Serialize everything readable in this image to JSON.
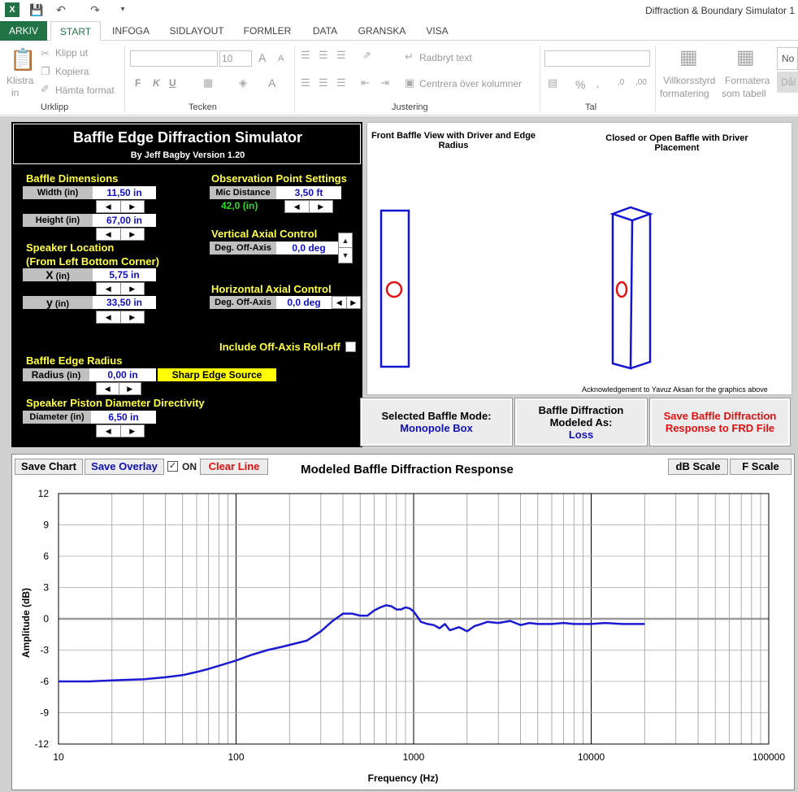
{
  "window": {
    "title": "Diffraction & Boundary Simulator 1"
  },
  "ribbon": {
    "tabs": [
      "ARKIV",
      "START",
      "INFOGA",
      "SIDLAYOUT",
      "FORMLER",
      "DATA",
      "GRANSKA",
      "VISA"
    ],
    "active_tab": "START",
    "clipboard": {
      "paste": "Klistra",
      "paste2": "in",
      "cut": "Klipp ut",
      "copy": "Kopiera",
      "format_painter": "Hämta format",
      "group": "Urklipp"
    },
    "font": {
      "size": "10",
      "bold": "F",
      "italic": "K",
      "underline": "U",
      "grow": "A",
      "shrink": "A",
      "color": "A",
      "group": "Tecken"
    },
    "alignment": {
      "wrap": "Radbryt text",
      "merge": "Centrera över kolumner",
      "group": "Justering"
    },
    "number": {
      "percent": "%",
      "comma": "‚",
      "dec_inc": ",0",
      "dec_dec": ",00",
      "group": "Tal"
    },
    "styles": {
      "conditional1": "Villkorsstyrd",
      "conditional2": "formatering",
      "table1": "Formatera",
      "table2": "som tabell",
      "normal": "No",
      "bad": "Dål"
    }
  },
  "simulator": {
    "title": "Baffle Edge Diffraction Simulator",
    "subtitle": "By Jeff Bagby Version 1.20",
    "baffle_dimensions": "Baffle Dimensions",
    "width_label": "Width (in)",
    "width_value": "11,50 in",
    "height_label": "Height (in)",
    "height_value": "67,00 in",
    "speaker_location": "Speaker Location",
    "speaker_location2": "(From Left Bottom Corner)",
    "x_label": "X",
    "x_unit": "(in)",
    "x_value": "5,75 in",
    "y_label": "y",
    "y_unit": "(in)",
    "y_value": "33,50 in",
    "obs_settings": "Observation Point Settings",
    "mic_label": "Mic Distance",
    "mic_value": "3,50 ft",
    "mic_in": "42,0 (in)",
    "vertical": "Vertical Axial Control",
    "v_label": "Deg. Off-Axis",
    "v_value": "0,0 deg",
    "horizontal": "Horizontal Axial Control",
    "h_label": "Deg. Off-Axis",
    "h_value": "0,0 deg",
    "rolloff": "Include Off-Axis Roll-off",
    "edge_radius": "Baffle Edge Radius",
    "radius_label": "Radius",
    "radius_unit": "(in)",
    "radius_value": "0,00 in",
    "sharp_edge": "Sharp Edge Source",
    "piston": "Speaker Piston Diameter Directivity",
    "diam_label": "Diameter (in)",
    "diam_value": "6,50 in"
  },
  "graphics": {
    "front_title": "Front Baffle View with Driver and Edge Radius",
    "box_title": "Closed or Open Baffle with Driver Placement",
    "ack": "Acknowledgement to Yavuz Aksan for the graphics above"
  },
  "modes": {
    "selected_label": "Selected Baffle Mode:",
    "selected_value": "Monopole Box",
    "modeled_label": "Baffle Diffraction Modeled As:",
    "modeled_value": "Loss",
    "save_frd": "Save Baffle Diffraction Response to FRD File"
  },
  "chart_controls": {
    "save_chart": "Save Chart",
    "save_overlay": "Save Overlay",
    "on": "ON",
    "clear_line": "Clear Line",
    "db_scale": "dB Scale",
    "f_scale": "F Scale"
  },
  "chart_data": {
    "type": "line",
    "title": "Modeled Baffle Diffraction Response",
    "xlabel": "Frequency (Hz)",
    "ylabel": "Amplitude (dB)",
    "xscale": "log",
    "xlim": [
      10,
      100000
    ],
    "ylim": [
      -12,
      12
    ],
    "xticks": [
      "10",
      "100",
      "1000",
      "10000",
      "100000"
    ],
    "yticks": [
      "12",
      "9",
      "6",
      "3",
      "0",
      "-3",
      "-6",
      "-9",
      "-12"
    ],
    "grid": true,
    "series": [
      {
        "color": "#1a1ad0",
        "x": [
          10,
          15,
          20,
          30,
          40,
          50,
          60,
          70,
          80,
          100,
          120,
          150,
          180,
          200,
          250,
          300,
          350,
          400,
          450,
          500,
          550,
          600,
          650,
          700,
          750,
          800,
          850,
          900,
          950,
          1000,
          1050,
          1100,
          1200,
          1300,
          1400,
          1500,
          1600,
          1800,
          2000,
          2200,
          2400,
          2600,
          3000,
          3500,
          4000,
          4500,
          5000,
          6000,
          7000,
          8000,
          10000,
          12000,
          15000,
          20000
        ],
        "y": [
          -6.0,
          -6.0,
          -5.9,
          -5.8,
          -5.6,
          -5.4,
          -5.1,
          -4.8,
          -4.5,
          -4.0,
          -3.5,
          -3.0,
          -2.7,
          -2.5,
          -2.1,
          -1.2,
          -0.2,
          0.5,
          0.5,
          0.3,
          0.3,
          0.8,
          1.1,
          1.3,
          1.2,
          0.9,
          0.9,
          1.1,
          1.0,
          0.7,
          0.2,
          -0.3,
          -0.5,
          -0.6,
          -0.9,
          -0.5,
          -1.1,
          -0.8,
          -1.2,
          -0.7,
          -0.5,
          -0.3,
          -0.4,
          -0.2,
          -0.6,
          -0.4,
          -0.5,
          -0.5,
          -0.4,
          -0.5,
          -0.5,
          -0.4,
          -0.5,
          -0.5
        ]
      }
    ]
  }
}
